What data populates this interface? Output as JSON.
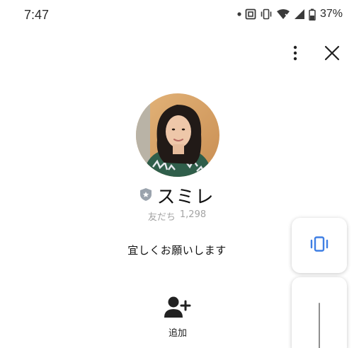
{
  "status_bar": {
    "time": "7:47",
    "battery_percent": "37%",
    "icons": [
      "notification-dot-icon",
      "nfc-icon",
      "vibrate-icon",
      "wifi-icon",
      "signal-icon",
      "battery-icon"
    ]
  },
  "header": {
    "actions": [
      "more-options-icon",
      "close-icon"
    ]
  },
  "profile": {
    "name": "スミレ",
    "badge_icon": "shield-star-icon",
    "friends_label": "友だち",
    "friends_count": "1,298",
    "status_message": "宜しくお願いします"
  },
  "actions": {
    "add_label": "追加",
    "add_icon": "add-friend-icon"
  },
  "volume_panel": {
    "mode_icon": "vibrate-icon",
    "accent_color": "#3f7fe4",
    "level": 0
  },
  "colors": {
    "background": "#ffffff",
    "badge": "#9aa3ad",
    "muted_text": "#a4a4a4"
  }
}
